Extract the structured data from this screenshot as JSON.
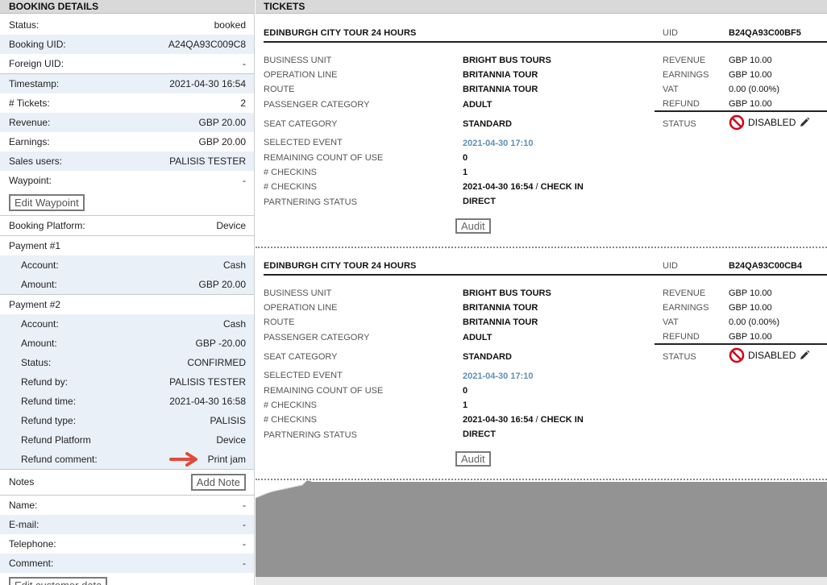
{
  "booking": {
    "header": "BOOKING DETAILS",
    "status_label": "Status:",
    "status": "booked",
    "uid_label": "Booking UID:",
    "uid": "A24QA93C009C8",
    "foreign_uid_label": "Foreign UID:",
    "foreign_uid": "-",
    "timestamp_label": "Timestamp:",
    "timestamp": "2021-04-30 16:54",
    "tickets_label": "# Tickets:",
    "tickets": "2",
    "revenue_label": "Revenue:",
    "revenue": "GBP 20.00",
    "earnings_label": "Earnings:",
    "earnings": "GBP 20.00",
    "sales_users_label": "Sales users:",
    "sales_users": "PALISIS TESTER",
    "waypoint_label": "Waypoint:",
    "waypoint": "-",
    "edit_waypoint": "Edit Waypoint",
    "platform_label": "Booking Platform:",
    "platform": "Device"
  },
  "payment1": {
    "title": "Payment #1",
    "account_label": "Account:",
    "account": "Cash",
    "amount_label": "Amount:",
    "amount": "GBP 20.00"
  },
  "payment2": {
    "title": "Payment #2",
    "account_label": "Account:",
    "account": "Cash",
    "amount_label": "Amount:",
    "amount": "GBP -20.00",
    "status_label": "Status:",
    "status": "CONFIRMED",
    "refund_by_label": "Refund by:",
    "refund_by": "PALISIS TESTER",
    "refund_time_label": "Refund time:",
    "refund_time": "2021-04-30 16:58",
    "refund_type_label": "Refund type:",
    "refund_type": "PALISIS",
    "refund_platform_label": "Refund Platform",
    "refund_platform": "Device",
    "refund_comment_label": "Refund comment:",
    "refund_comment": "Print jam"
  },
  "notes": {
    "label": "Notes",
    "add_note": "Add Note"
  },
  "customer": {
    "name_label": "Name:",
    "name": "-",
    "email_label": "E-mail:",
    "email": "-",
    "telephone_label": "Telephone:",
    "telephone": "-",
    "comment_label": "Comment:",
    "comment": "-",
    "edit_button": "Edit customer data"
  },
  "tickets_header": "TICKETS",
  "labels": {
    "uid": "UID",
    "business_unit": "BUSINESS UNIT",
    "operation_line": "OPERATION LINE",
    "route": "ROUTE",
    "passenger_category": "PASSENGER CATEGORY",
    "seat_category": "SEAT CATEGORY",
    "selected_event": "SELECTED EVENT",
    "remaining_count": "REMAINING COUNT OF USE",
    "checkins": "# CHECKINS",
    "partnering_status": "PARTNERING STATUS",
    "revenue": "REVENUE",
    "earnings": "EARNINGS",
    "vat": "VAT",
    "refund": "REFUND",
    "status": "STATUS",
    "audit": "Audit"
  },
  "tickets": [
    {
      "title": "EDINBURGH CITY TOUR 24 HOURS",
      "uid": "B24QA93C00BF5",
      "business_unit": "BRIGHT BUS TOURS",
      "operation_line": "BRITANNIA TOUR",
      "route": "BRITANNIA TOUR",
      "passenger_category": "ADULT",
      "seat_category": "STANDARD",
      "selected_event": "2021-04-30 17:10",
      "remaining_count": "0",
      "checkins_count": "1",
      "checkin_time": "2021-04-30 16:54",
      "checkin_sep": " / ",
      "checkin_type": "CHECK IN",
      "partnering_status": "DIRECT",
      "revenue": "GBP 10.00",
      "earnings": "GBP 10.00",
      "vat": "0.00 (0.00%)",
      "refund": "GBP 10.00",
      "status": "DISABLED"
    },
    {
      "title": "EDINBURGH CITY TOUR 24 HOURS",
      "uid": "B24QA93C00CB4",
      "business_unit": "BRIGHT BUS TOURS",
      "operation_line": "BRITANNIA TOUR",
      "route": "BRITANNIA TOUR",
      "passenger_category": "ADULT",
      "seat_category": "STANDARD",
      "selected_event": "2021-04-30 17:10",
      "remaining_count": "0",
      "checkins_count": "1",
      "checkin_time": "2021-04-30 16:54",
      "checkin_sep": " / ",
      "checkin_type": "CHECK IN",
      "partnering_status": "DIRECT",
      "revenue": "GBP 10.00",
      "earnings": "GBP 10.00",
      "vat": "0.00 (0.00%)",
      "refund": "GBP 10.00",
      "status": "DISABLED"
    }
  ],
  "colors": {
    "alt_row": "#e9f0f8",
    "link": "#5f8fb5",
    "disabled": "#d0021b",
    "arrow": "#e04a3a",
    "torn_area": "#939393"
  }
}
